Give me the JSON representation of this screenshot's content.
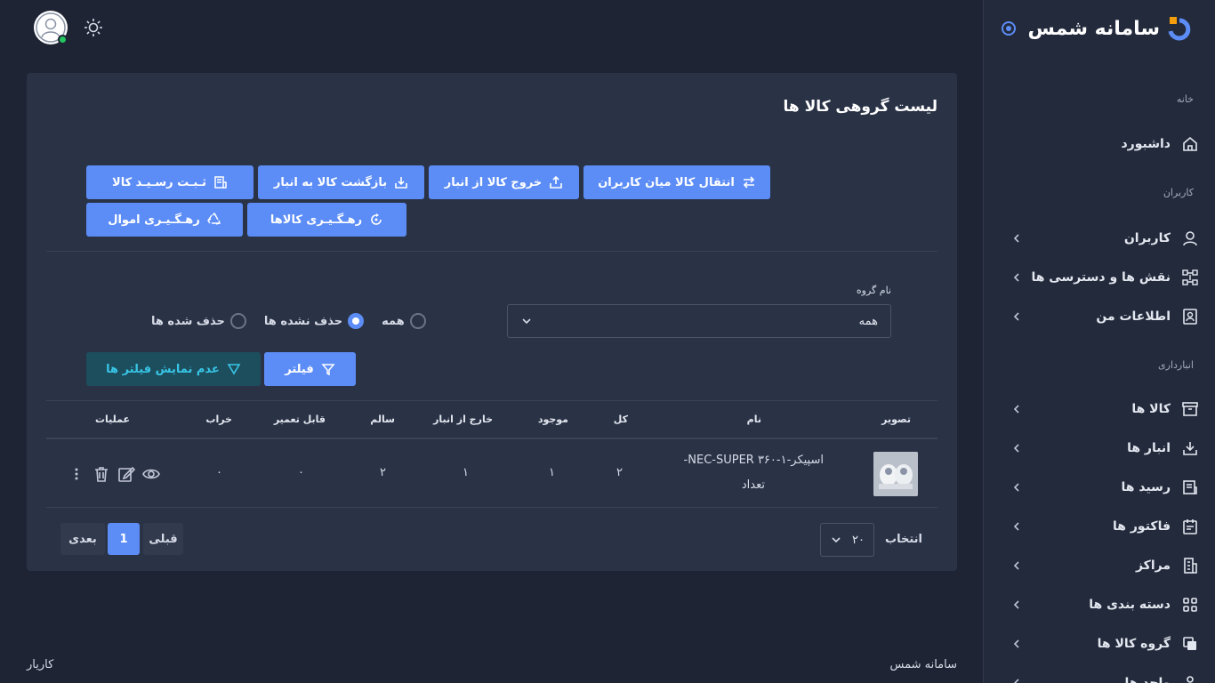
{
  "brand": {
    "name": "سامانه شمس"
  },
  "sidebar": {
    "sections": [
      {
        "title": "خانه"
      },
      {
        "title": "کاربران"
      },
      {
        "title": "انبارداری"
      }
    ],
    "items": [
      {
        "label": "داشبورد",
        "icon": "home-icon"
      },
      {
        "label": "کاربران",
        "icon": "user-icon"
      },
      {
        "label": "نقش ها و دسترسی ها",
        "icon": "roles-icon"
      },
      {
        "label": "اطلاعات من",
        "icon": "id-card-icon"
      },
      {
        "label": "کالا ها",
        "icon": "archive-box-icon"
      },
      {
        "label": "انبار ها",
        "icon": "warehouse-download-icon"
      },
      {
        "label": "رسید ها",
        "icon": "receipt-icon"
      },
      {
        "label": "فاکتور ها",
        "icon": "invoice-icon"
      },
      {
        "label": "مراکز",
        "icon": "building-icon"
      },
      {
        "label": "دسته بندی ها",
        "icon": "grid-icon"
      },
      {
        "label": "گروه کالا ها",
        "icon": "stack-icon"
      },
      {
        "label": "واحد ها",
        "icon": "unit-icon"
      }
    ]
  },
  "page": {
    "title": "لیست گروهی کالا ها",
    "actions": [
      {
        "label": "انتقال کالا میان کاربران",
        "icon": "transfer-icon"
      },
      {
        "label": "خروج کالا از انبار",
        "icon": "export-icon"
      },
      {
        "label": "بازگشت کالا به انبار",
        "icon": "import-icon"
      },
      {
        "label": "ثـبـت رسـیـد کالا",
        "icon": "receipt-register-icon"
      },
      {
        "label": "رهـگـیـری کالاها",
        "icon": "track-icon"
      },
      {
        "label": "رهـگـیـری اموال",
        "icon": "recycle-icon"
      }
    ]
  },
  "filters": {
    "group_label": "نام گروه",
    "group_value": "همه",
    "radios": [
      {
        "label": "همه",
        "checked": false
      },
      {
        "label": "حذف نشده ها",
        "checked": true
      },
      {
        "label": "حذف شده ها",
        "checked": false
      }
    ],
    "filter_button": "فیلتر",
    "hide_filters_button": "عدم نمایش فیلتر ها"
  },
  "table": {
    "headers": [
      "تصویر",
      "نام",
      "کل",
      "موجود",
      "خارج از انبار",
      "سالم",
      "قابل تعمیر",
      "خراب",
      "عملیات"
    ],
    "rows": [
      {
        "name_line1": "اسپیکر-۱-۳۶۰ NEC-SUPER-",
        "name_line2": "تعداد",
        "total": "۲",
        "available": "۱",
        "out": "۱",
        "healthy": "۲",
        "repairable": "۰",
        "broken": "۰"
      }
    ]
  },
  "pagination": {
    "per_page_label": "انتخاب",
    "per_page_value": "۲۰",
    "prev": "قبلی",
    "current": "1",
    "next": "بعدی"
  },
  "footer": {
    "right": "سامانه شمس",
    "left": "کاریار"
  },
  "colors": {
    "primary": "#5c8df6",
    "background": "#1e2434",
    "card": "#2a3246",
    "sidebar": "#232a3c",
    "info_text": "#38c6e6",
    "online": "#22c55e"
  }
}
